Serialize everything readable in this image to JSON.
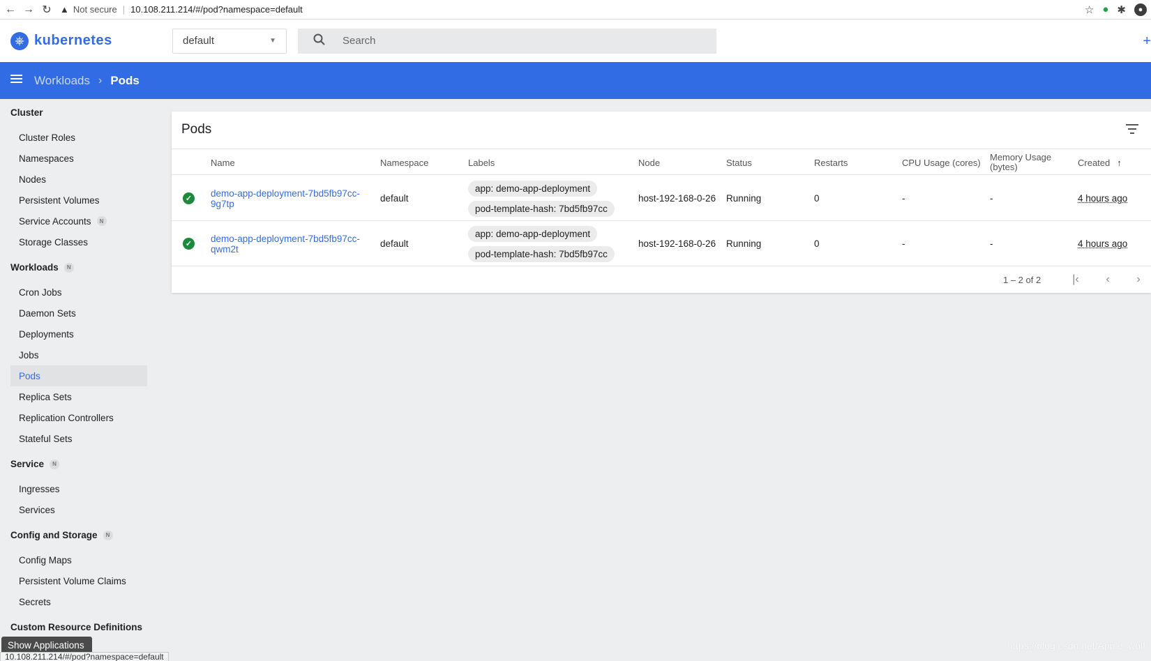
{
  "browser": {
    "back_icon": "←",
    "forward_icon": "→",
    "reload_icon": "↻",
    "warning_icon": "▲",
    "security_label": "Not secure",
    "url": "10.108.211.214/#/pod?namespace=default"
  },
  "header": {
    "brand": "kubernetes",
    "namespace": "default",
    "search_placeholder": "Search"
  },
  "breadcrumb": {
    "parent": "Workloads",
    "separator": "›",
    "current": "Pods"
  },
  "sidebar": {
    "sections": [
      {
        "title": "Cluster",
        "badge": "",
        "items": [
          "Cluster Roles",
          "Namespaces",
          "Nodes",
          "Persistent Volumes",
          "Service Accounts",
          "Storage Classes"
        ]
      },
      {
        "title": "Workloads",
        "badge": "N",
        "items": [
          "Cron Jobs",
          "Daemon Sets",
          "Deployments",
          "Jobs",
          "Pods",
          "Replica Sets",
          "Replication Controllers",
          "Stateful Sets"
        ]
      },
      {
        "title": "Service",
        "badge": "N",
        "items": [
          "Ingresses",
          "Services"
        ]
      },
      {
        "title": "Config and Storage",
        "badge": "N",
        "items": [
          "Config Maps",
          "Persistent Volume Claims",
          "Secrets"
        ]
      },
      {
        "title": "Custom Resource Definitions",
        "badge": "",
        "items": []
      }
    ],
    "service_accounts_badge": "N",
    "active_item": "Pods"
  },
  "card": {
    "title": "Pods",
    "columns": [
      "Name",
      "Namespace",
      "Labels",
      "Node",
      "Status",
      "Restarts",
      "CPU Usage (cores)",
      "Memory Usage (bytes)",
      "Created"
    ],
    "memory_col_line1": "Memory Usage",
    "memory_col_line2": "(bytes)",
    "rows": [
      {
        "name_line1": "demo-app-deployment-7bd5fb97cc-",
        "name_line2": "9g7tp",
        "namespace": "default",
        "labels": [
          "app: demo-app-deployment",
          "pod-template-hash: 7bd5fb97cc"
        ],
        "node": "host-192-168-0-26",
        "status": "Running",
        "restarts": "0",
        "cpu": "-",
        "memory": "-",
        "created": "4 hours ago"
      },
      {
        "name_line1": "demo-app-deployment-7bd5fb97cc-",
        "name_line2": "qwm2t",
        "namespace": "default",
        "labels": [
          "app: demo-app-deployment",
          "pod-template-hash: 7bd5fb97cc"
        ],
        "node": "host-192-168-0-26",
        "status": "Running",
        "restarts": "0",
        "cpu": "-",
        "memory": "-",
        "created": "4 hours ago"
      }
    ],
    "pager_range": "1 – 2 of 2"
  },
  "overlay": {
    "tooltip": "Show Applications",
    "status_url": "10.108.211.214/#/pod?namespace=default",
    "watermark": "https://blog.csdn.net/Apple_wolf"
  },
  "colors": {
    "brand_blue": "#326ce5",
    "status_green": "#1b8a3a"
  }
}
